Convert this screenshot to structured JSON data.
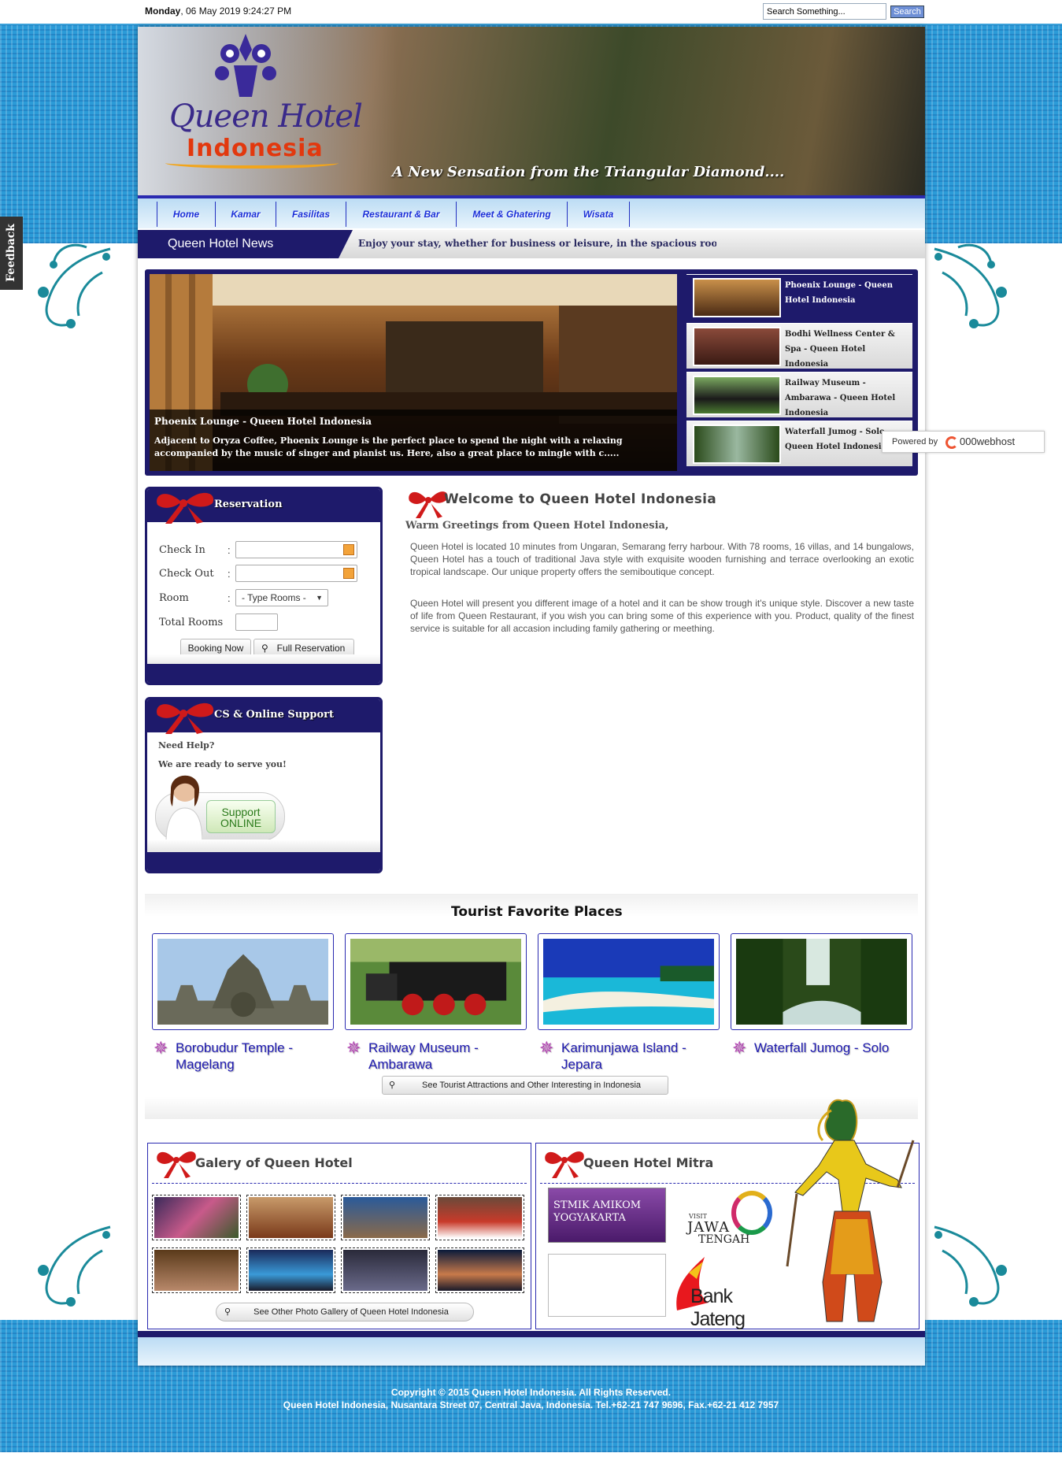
{
  "topbar": {
    "date_day": "Monday",
    "date_rest": ", 06 May 2019 9:24:27 PM",
    "search_value": "Search Something...",
    "search_button": "Search"
  },
  "header": {
    "logo_line1": "Queen Hotel",
    "logo_line2": "Indonesia",
    "tagline": "A New Sensation from the Triangular Diamond...."
  },
  "nav": {
    "items": [
      "Home",
      "Kamar",
      "Fasilitas",
      "Restaurant & Bar",
      "Meet & Ghatering",
      "Wisata"
    ]
  },
  "news": {
    "label": "Queen Hotel News",
    "ticker": "Enjoy your stay, whether for business or leisure, in the spacious rooms and su_"
  },
  "slider": {
    "title": "Phoenix Lounge - Queen Hotel Indonesia",
    "description": "Adjacent to Oryza Coffee, Phoenix Lounge is the perfect place to spend the night with a relaxing accompanied by the music of singer and pianist us. Here, also a great place to mingle with c.....",
    "thumbs": [
      "Phoenix Lounge - Queen Hotel Indonesia",
      "Bodhi Wellness Center & Spa - Queen Hotel Indonesia",
      "Railway Museum - Ambarawa - Queen Hotel Indonesia",
      "Waterfall Jumog - Solo - Queen Hotel Indonesia"
    ]
  },
  "powered": {
    "prefix": "Powered by",
    "brand": "000webhost"
  },
  "feedback": "Feedback",
  "reservation": {
    "title": "Reservation",
    "check_in": "Check In",
    "check_out": "Check Out",
    "room": "Room",
    "total_rooms": "Total Rooms",
    "colon": ":",
    "room_select": "- Type Rooms -",
    "booking_button": "Booking Now",
    "full_button": "Full Reservation"
  },
  "support": {
    "title": "CS & Online Support",
    "need_help": "Need Help?",
    "ready": "We are ready to serve you!",
    "badge_line1": "Support",
    "badge_line2": "ONLINE"
  },
  "welcome": {
    "title": "Welcome to Queen Hotel Indonesia",
    "subtitle": "Warm Greetings from Queen Hotel Indonesia,",
    "para1": "Queen Hotel is located 10 minutes from Ungaran, Semarang ferry harbour. With 78 rooms, 16 villas, and 14 bungalows, Queen Hotel has a touch of traditional Java style with exquisite wooden furnishing and terrace overlooking an exotic tropical landscape. Our unique property offers the semiboutique concept.",
    "para2": "Queen Hotel will present you different image of a hotel and it can be show trough it's unique style. Discover a new taste of life from Queen Restaurant, if you wish you can bring some of this experience with you. Product, quality of the finest service is suitable for all accasion including family gathering or meething."
  },
  "tourist": {
    "title": "Tourist Favorite Places",
    "places": [
      "Borobudur Temple - Magelang",
      "Railway Museum - Ambarawa",
      "Karimunjawa Island - Jepara",
      "Waterfall Jumog - Solo"
    ],
    "more_button": "See Tourist Attractions and Other Interesting in Indonesia"
  },
  "gallery": {
    "title": "Galery of Queen Hotel",
    "more_button": "See Other Photo Gallery of Queen Hotel Indonesia"
  },
  "mitra": {
    "title": "Queen Hotel Mitra",
    "stmik_line1": "STMIK",
    "stmik_line2": "AMIKOM",
    "stmik_line3": "YOGYAKARTA",
    "visit": "VISIT",
    "jawa": "JAWA",
    "tengah": "TENGAH",
    "bank": "Bank Jateng"
  },
  "footer": {
    "line1": "Copyright © 2015 Queen Hotel Indonesia. All Rights Reserved.",
    "line2": "Queen Hotel Indonesia, Nusantara Street 07, Central Java, Indonesia. Tel.+62-21 747 9696, Fax.+62-21 412 7957"
  },
  "colors": {
    "navy": "#1e1a6b",
    "sky": "#2b9bd8",
    "nav_link": "#1a2fd8",
    "place_link": "#1e1ab0"
  }
}
